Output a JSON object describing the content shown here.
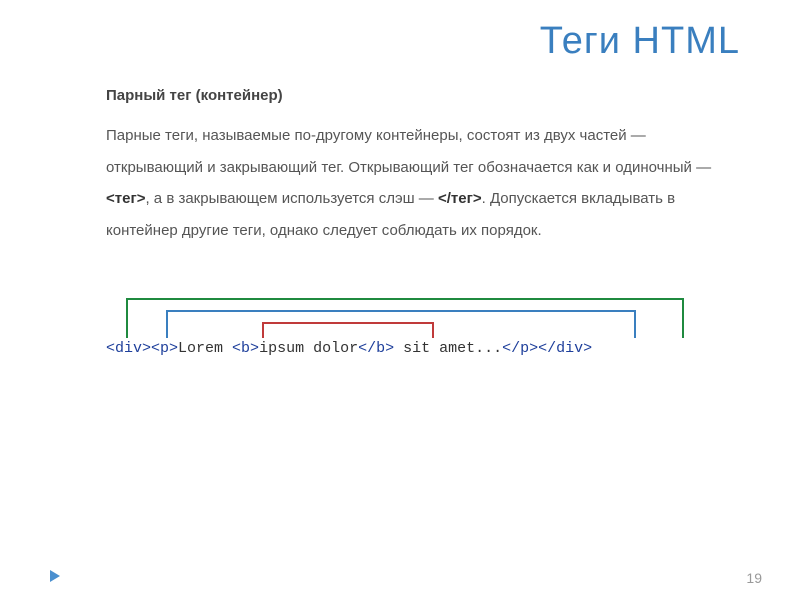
{
  "title": "Теги HTML",
  "subtitle": "Парный тег (контейнер)",
  "body_parts": {
    "p1": "Парные теги, называемые по-другому контейнеры, состоят из двух частей — открывающий и закрывающий тег. Открывающий тег обозначается как и одиночный — ",
    "tag_open": "<тег>",
    "p2": ", а в закрывающем используется слэш — ",
    "tag_close": "</тег>",
    "p3": ". Допускается вкладывать в контейнер другие теги, однако следует соблюдать их порядок."
  },
  "code": {
    "div_open": "<div>",
    "p_open": "<p>",
    "t1": "Lorem ",
    "b_open": "<b>",
    "t2": "ipsum dolor",
    "b_close": "</b>",
    "t3": " sit amet...",
    "p_close": "</p>",
    "div_close": "</div>"
  },
  "brackets": {
    "outer_color": "#1f8a3f",
    "mid_color": "#3a7fbf",
    "inner_color": "#c03a3a"
  },
  "page_number": "19"
}
